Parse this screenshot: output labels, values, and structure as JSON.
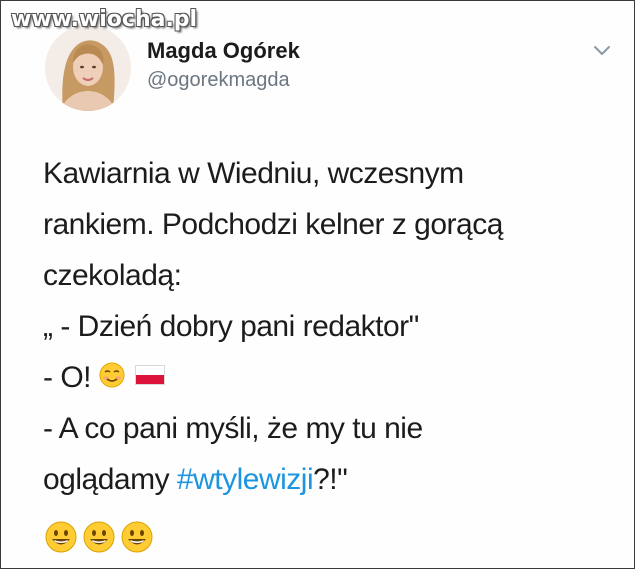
{
  "watermark": "www.wiocha.pl",
  "author": {
    "display_name": "Magda Ogórek",
    "handle": "@ogorekmagda"
  },
  "tweet": {
    "line1": "Kawiarnia w Wiedniu, wczesnym",
    "line2": "rankiem. Podchodzi kelner z gorącą",
    "line3": "czekoladą:",
    "line4": "„ - Dzień dobry pani redaktor\"",
    "line5": "- O!",
    "line6": "- A co pani myśli, że my tu nie",
    "line7_before": "oglądamy ",
    "hashtag": "#wtylewizji",
    "line7_after": "?!\""
  },
  "icons": {
    "menu": "chevron-down-icon",
    "smile": "smiling-face-emoji",
    "flag": "poland-flag-emoji",
    "grin": "grinning-face-emoji"
  },
  "colors": {
    "hashtag": "#1b95e0",
    "handle": "#6b7680",
    "text": "#1c1c1c"
  }
}
